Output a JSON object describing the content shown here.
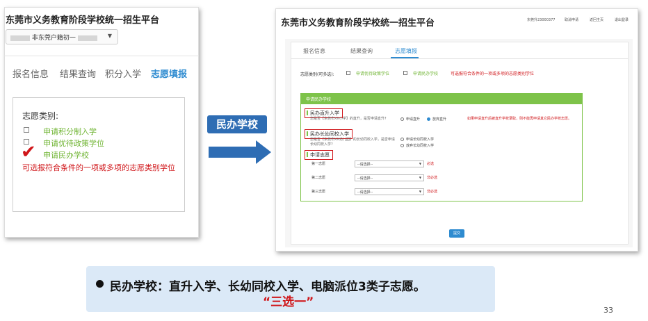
{
  "left": {
    "title": "东莞市义务教育阶段学校统一招生平台",
    "select_text": "非东莞户籍初一",
    "tabs": [
      "报名信息",
      "结果查询",
      "积分入学",
      "志愿填报"
    ],
    "category_label": "志愿类别:",
    "options": [
      "申请积分制入学",
      "申请优待政策学位",
      "申请民办学校"
    ],
    "checkmark": "✔",
    "note": "可选报符合条件的一项或多项的志愿类别学位"
  },
  "middle": {
    "label": "民办学校"
  },
  "right": {
    "title": "东莞市义务教育阶段学校统一招生平台",
    "nav": [
      "东莞升23000377",
      "取消申请",
      "返回主页",
      "退出登录"
    ],
    "tabs": [
      "报名信息",
      "结果查询",
      "志愿填报"
    ],
    "category_label": "志愿类别(可多选):",
    "options": [
      "申请优待政策学位",
      "申请民办学校"
    ],
    "note": "可选报符合条件的一项或多项的志愿类别学位",
    "panel_header": "申请民办学校",
    "sections": {
      "direct": {
        "title": "民办直升入学",
        "question": "您是否【东莞市XX小学】的直升，是否申请直升?",
        "radio_apply": "申请直升",
        "radio_waive": "放弃直升",
        "note": "如果申请直升后被直升学校录取，则不能再申请其它民办学校志愿。"
      },
      "kindergarten": {
        "title": "民办长幼同校入学",
        "question": "您是否【东莞市XX幼儿园】的长幼同校入学，是否申请长幼同校入学?",
        "radio_apply": "申请长幼同校入学",
        "radio_waive": "放弃长幼同校入学"
      },
      "choices": {
        "title": "申请志愿",
        "items": [
          {
            "label": "第一志愿",
            "select": "--请选择--",
            "req": "必选"
          },
          {
            "label": "第二志愿",
            "select": "--请选择--",
            "req": "非必选"
          },
          {
            "label": "第三志愿",
            "select": "--请选择--",
            "req": "非必选"
          }
        ]
      }
    },
    "submit": "提交"
  },
  "callout": {
    "text": "民办学校：直升入学、长幼同校入学、电脑派位3类子志愿。",
    "emphasis": "“三选一”"
  },
  "page_number": "33"
}
